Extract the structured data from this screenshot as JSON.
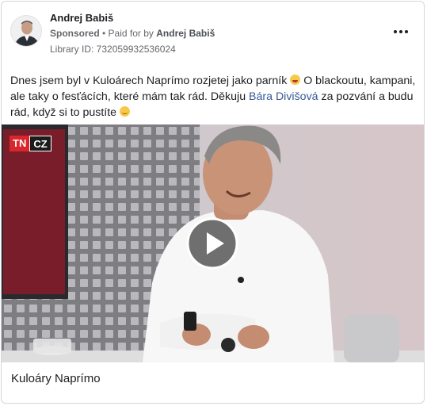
{
  "post": {
    "page_name": "Andrej Babiš",
    "sponsored_label": "Sponsored",
    "paid_for_prefix": " • Paid for by ",
    "paid_for_name": "Andrej Babiš",
    "library_id": "Library ID: 732059932536024",
    "more_icon": "more-horizontal-icon",
    "text_part1": "Dnes jsem byl v Kuloárech Naprímo rozjetej jako parník ",
    "text_part2": "  O blackoutu, kampani, ale taky o fesťácích, které mám tak rád. Děkuju ",
    "mention": "Bára Divišová",
    "text_part3": " za pozvání a budu rád, když si to pustíte ",
    "caption": "Kuloáry Naprímo"
  },
  "video": {
    "logo_tn": "TN",
    "logo_cz": "CZ",
    "play_icon": "play-icon",
    "accent": "#d9252c"
  }
}
